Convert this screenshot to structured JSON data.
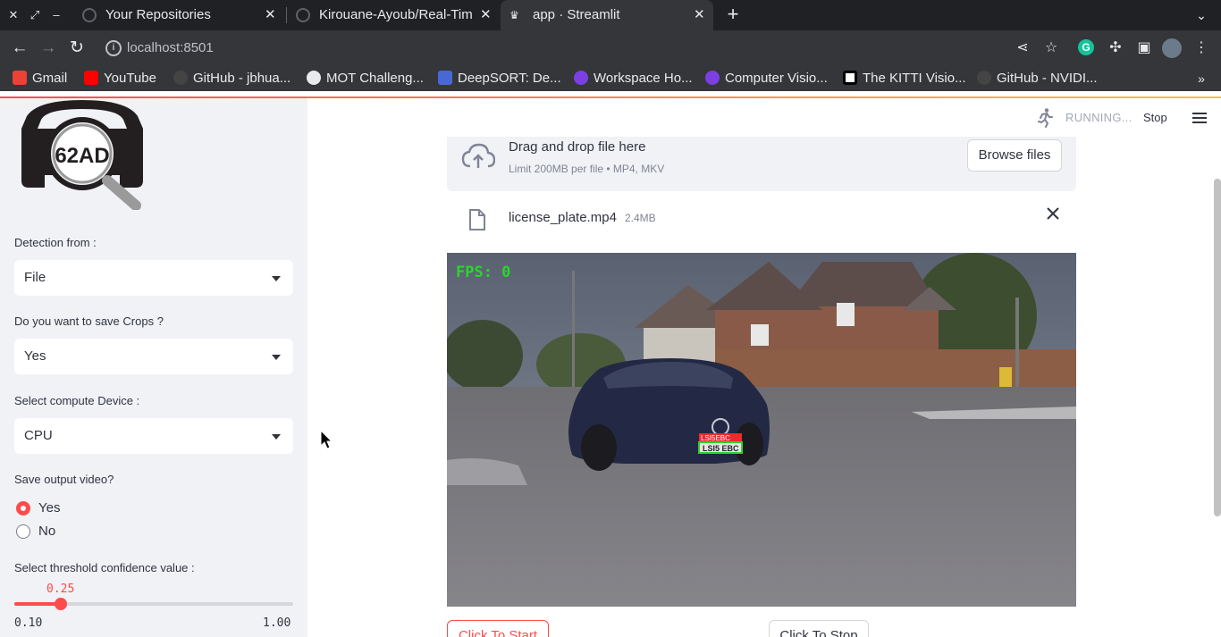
{
  "browser": {
    "tabs": [
      {
        "title": "Your Repositories"
      },
      {
        "title": "Kirouane-Ayoub/Real-Tim"
      },
      {
        "title": "app · Streamlit"
      }
    ],
    "url": "localhost:8501",
    "bookmarks": [
      {
        "label": "Gmail"
      },
      {
        "label": "YouTube"
      },
      {
        "label": "GitHub - jbhua..."
      },
      {
        "label": "MOT Challeng..."
      },
      {
        "label": "DeepSORT: De..."
      },
      {
        "label": "Workspace Ho..."
      },
      {
        "label": "Computer Visio..."
      },
      {
        "label": "The KITTI Visio..."
      },
      {
        "label": "GitHub - NVIDI..."
      }
    ]
  },
  "sidebar": {
    "logo_text": "62AD",
    "detection_label": "Detection from :",
    "detection_value": "File",
    "save_crops_label": "Do you want to save Crops ?",
    "save_crops_value": "Yes",
    "device_label": "Select compute Device :",
    "device_value": "CPU",
    "save_video_label": "Save output video?",
    "save_video_options": [
      "Yes",
      "No"
    ],
    "save_video_selected": "Yes",
    "threshold_label": "Select threshold confidence value :",
    "threshold_value": "0.25",
    "threshold_min": "0.10",
    "threshold_max": "1.00",
    "threshold_fraction": 0.1667
  },
  "header": {
    "status_text": "RUNNING...",
    "stop_label": "Stop"
  },
  "uploader": {
    "title": "Drag and drop file here",
    "limit_text": "Limit 200MB per file • MP4, MKV",
    "browse_label": "Browse files",
    "file_name": "license_plate.mp4",
    "file_size": "2.4MB"
  },
  "video": {
    "fps_text": "FPS: 0",
    "plate_label": "LSI5EBC",
    "plate_text": "LSI5 EBC"
  },
  "buttons": {
    "start_label": "Click To Start",
    "stop_label": "Click To Stop"
  },
  "colors": {
    "accent": "#ff4b4b",
    "sidebar_bg": "#f0f2f6",
    "text": "#31333f"
  }
}
